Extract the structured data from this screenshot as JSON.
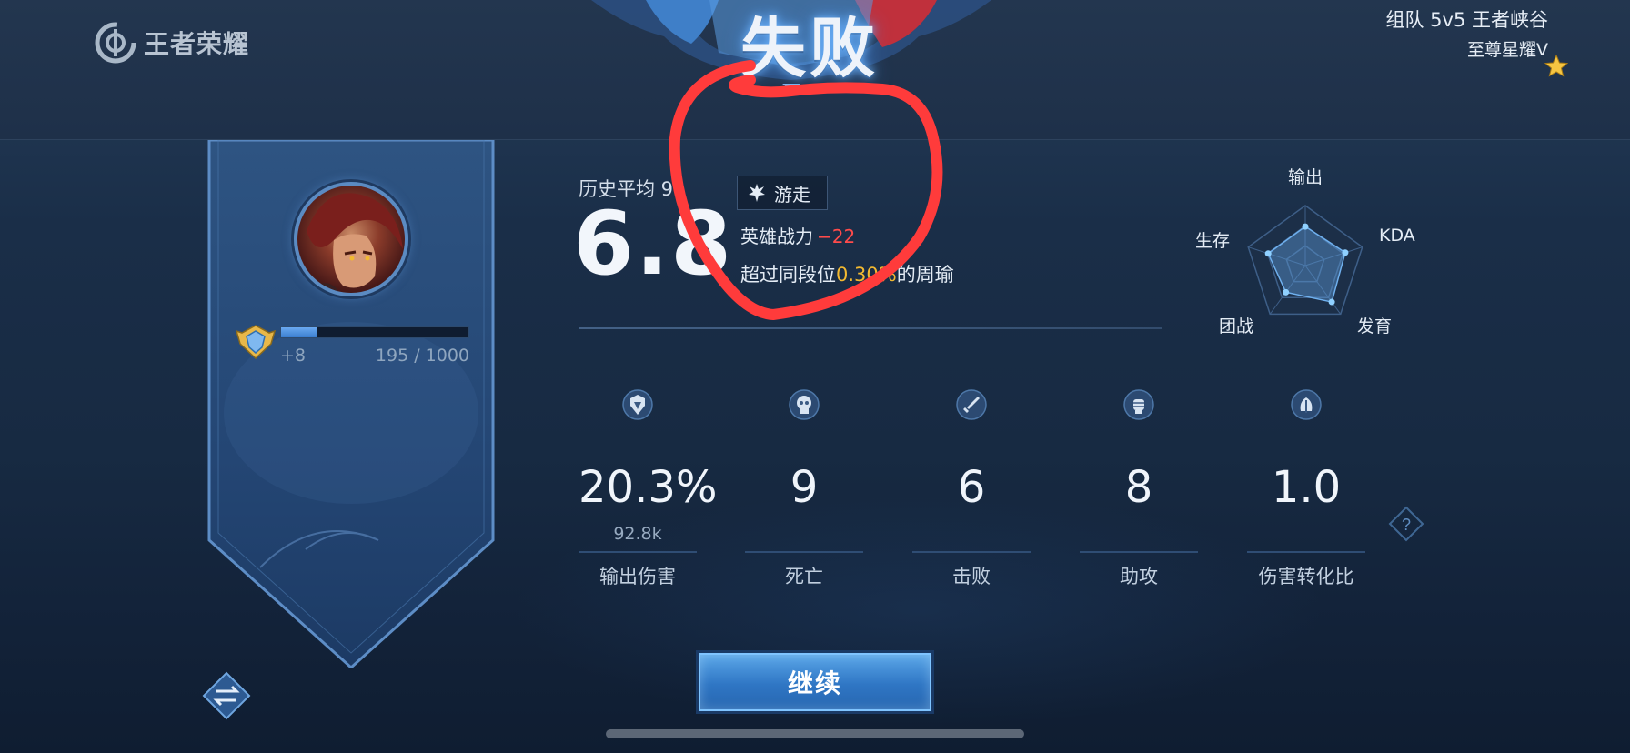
{
  "app": {
    "logo_text": "王者荣耀"
  },
  "match": {
    "mode": "组队 5v5 王者峡谷",
    "rank": "至尊星耀V",
    "result_title": "失败"
  },
  "player": {
    "xp_gain": "+8",
    "xp_progress": "195 / 1000",
    "xp_fraction": 0.195
  },
  "score": {
    "history_avg_label": "历史平均 9.",
    "value": "6.8",
    "role": "游走",
    "power_label": "英雄战力",
    "power_delta": "−22",
    "surpass_prefix": "超过同段位",
    "surpass_pct": "0.30%",
    "surpass_suffix": "的周瑜"
  },
  "radar": {
    "labels": [
      "输出",
      "KDA",
      "发育",
      "团战",
      "生存"
    ],
    "values": [
      0.65,
      0.7,
      0.75,
      0.55,
      0.65
    ]
  },
  "stats": [
    {
      "icon": "output-icon",
      "value": "20.3%",
      "sub": "92.8k",
      "label": "输出伤害"
    },
    {
      "icon": "skull-icon",
      "value": "9",
      "sub": "",
      "label": "死亡"
    },
    {
      "icon": "sword-icon",
      "value": "6",
      "sub": "",
      "label": "击败"
    },
    {
      "icon": "fist-icon",
      "value": "8",
      "sub": "",
      "label": "助攻"
    },
    {
      "icon": "conversion-icon",
      "value": "1.0",
      "sub": "",
      "label": "伤害转化比"
    }
  ],
  "actions": {
    "continue_label": "继续"
  },
  "colors": {
    "accent": "#4a90e2",
    "negative": "#ff4b4b",
    "highlight": "#f2b931",
    "annotation": "#ff3b3b"
  }
}
